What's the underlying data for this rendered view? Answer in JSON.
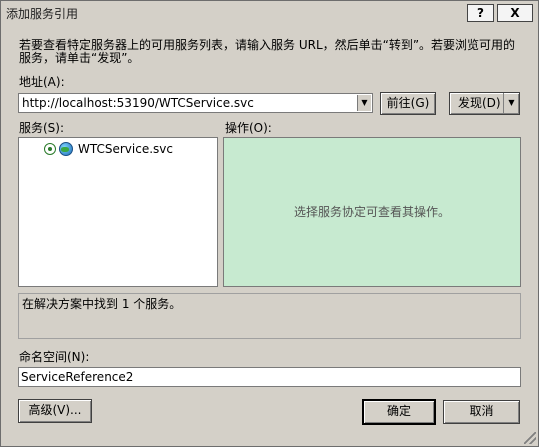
{
  "window": {
    "title": "添加服务引用",
    "help_label": "?",
    "close_label": "X"
  },
  "description": "若要查看特定服务器上的可用服务列表，请输入服务 URL，然后单击“转到”。若要浏览可用的服务，请单击“发现”。",
  "address": {
    "label": "地址(A):",
    "value": "http://localhost:53190/WTCService.svc",
    "go_label": "前往(G)",
    "discover_label": "发现(D)"
  },
  "services": {
    "label": "服务(S):",
    "items": [
      {
        "label": "WTCService.svc"
      }
    ]
  },
  "operations": {
    "label": "操作(O):",
    "empty_message": "选择服务协定可查看其操作。"
  },
  "status": "在解决方案中找到 1 个服务。",
  "namespace": {
    "label": "命名空间(N):",
    "value": "ServiceReference2"
  },
  "buttons": {
    "advanced": "高级(V)...",
    "ok": "确定",
    "cancel": "取消"
  },
  "colors": {
    "dialog_bg": "#d4d0c8",
    "operations_bg": "#c7ead0"
  }
}
